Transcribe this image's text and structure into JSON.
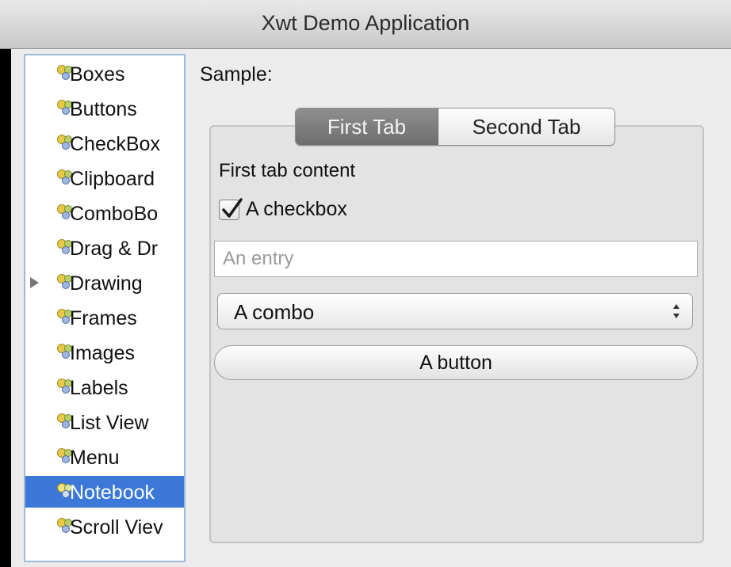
{
  "window": {
    "title": "Xwt Demo Application"
  },
  "sidebar": {
    "selected_index": 12,
    "items": [
      {
        "label": "Boxes"
      },
      {
        "label": "Buttons"
      },
      {
        "label": "CheckBox"
      },
      {
        "label": "Clipboard"
      },
      {
        "label": "ComboBo"
      },
      {
        "label": "Drag & Dr"
      },
      {
        "label": "Drawing",
        "expandable": true
      },
      {
        "label": "Frames"
      },
      {
        "label": "Images"
      },
      {
        "label": "Labels"
      },
      {
        "label": "List View"
      },
      {
        "label": "Menu"
      },
      {
        "label": "Notebook"
      },
      {
        "label": "Scroll Viev"
      }
    ]
  },
  "sample": {
    "label": "Sample:"
  },
  "notebook": {
    "tabs": [
      {
        "label": "First Tab",
        "active": true
      },
      {
        "label": "Second Tab",
        "active": false
      }
    ],
    "content_label": "First tab content",
    "checkbox": {
      "label": "A checkbox",
      "checked": true
    },
    "entry": {
      "placeholder": "An entry",
      "value": ""
    },
    "combo": {
      "value": "A combo"
    },
    "button": {
      "label": "A button"
    }
  },
  "colors": {
    "selection": "#3b78d8",
    "sidebar_border": "#9fb8d8",
    "active_tab": "#7d7d7d"
  },
  "icons": {
    "tree_item": "widget-icon",
    "expander": "disclosure-triangle-icon",
    "combo": "up-down-arrows-icon",
    "checkmark": "checkmark-icon"
  }
}
